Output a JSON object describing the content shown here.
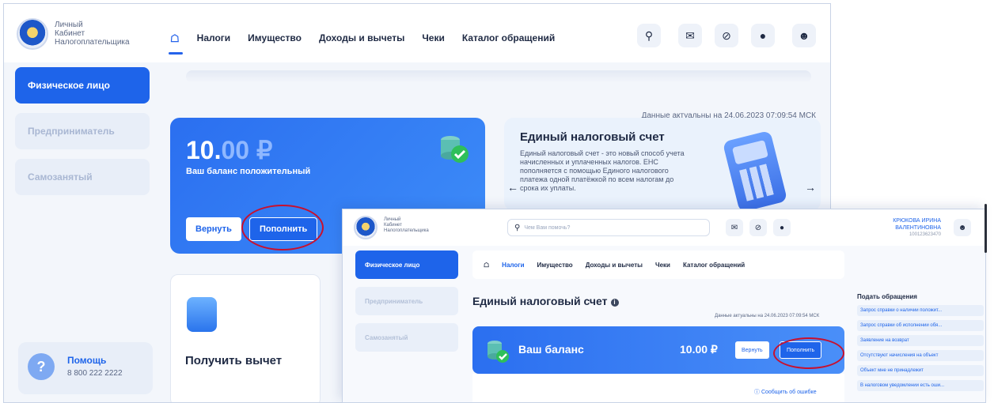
{
  "screen_back": {
    "logo_text": [
      "Личный",
      "Кабинет",
      "Налогоплательщика"
    ],
    "nav": [
      "Налоги",
      "Имущество",
      "Доходы и вычеты",
      "Чеки",
      "Каталог обращений"
    ],
    "sidebar": [
      "Физическое лицо",
      "Предприниматель",
      "Самозанятый"
    ],
    "data_actual": "Данные актуальны на 24.06.2023 07:09:54 МСК",
    "balance": {
      "amount_int": "10.",
      "amount_frac": "00 ₽",
      "caption": "Ваш баланс положительный",
      "return_label": "Вернуть",
      "topup_label": "Пополнить"
    },
    "ens_card": {
      "title": "Единый налоговый счет",
      "description": "Единый налоговый счет - это новый способ учета начисленных и уплаченных налогов. ЕНС пополняется с помощью Единого налогового платежа одной платёжкой по всем налогам до срока их уплаты."
    },
    "deduction_label": "Получить вычет",
    "help": {
      "title": "Помощь",
      "phone": "8 800 222 2222"
    }
  },
  "screen_front": {
    "logo_text": [
      "Личный",
      "Кабинет",
      "Налогоплательщика"
    ],
    "search_placeholder": "Чем Вам помочь?",
    "user": {
      "name1": "КРЮКОВА ИРИНА",
      "name2": "ВАЛЕНТИНОВНА",
      "inn": "100123623470"
    },
    "sidebar": [
      "Физическое лицо",
      "Предприниматель",
      "Самозанятый"
    ],
    "nav": [
      "Налоги",
      "Имущество",
      "Доходы и вычеты",
      "Чеки",
      "Каталог обращений"
    ],
    "heading": "Единый налоговый счет",
    "data_actual": "Данные актуальны на 24.06.2023 07:09:54 МСК",
    "balance": {
      "label": "Ваш баланс",
      "amount": "10.00 ₽",
      "return_label": "Вернуть",
      "topup_label": "Пополнить"
    },
    "report_error": "Сообщить об ошибке",
    "appeals": {
      "title": "Подать обращения",
      "items": [
        "Запрос справки о наличии положит...",
        "Запрос справки об исполнении обя...",
        "Заявление на возврат",
        "Отсутствуют начисления на объект",
        "Объект мне не принадлежит",
        "В налоговом уведомлении есть оши..."
      ]
    }
  },
  "colors": {
    "accent": "#1e64ea",
    "highlight_ring": "#c8102e"
  },
  "icons": [
    "home-icon",
    "search-icon",
    "mail-icon",
    "eye-off-icon",
    "lightbulb-icon",
    "user-icon",
    "coins-icon",
    "wallet-icon",
    "help-icon",
    "info-icon",
    "arrow-left-icon",
    "arrow-right-icon"
  ]
}
